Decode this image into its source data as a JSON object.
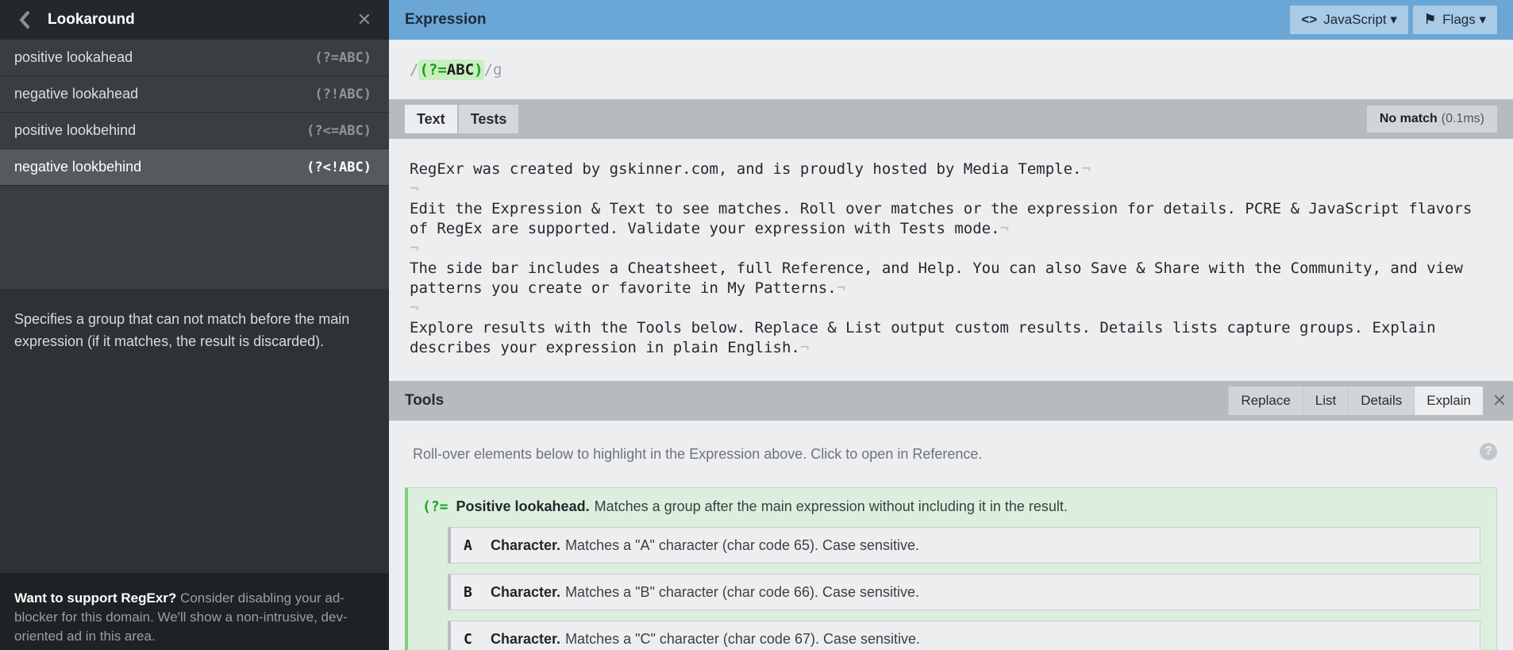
{
  "sidebar": {
    "title": "Lookaround",
    "items": [
      {
        "label": "positive lookahead",
        "code": "(?=ABC)"
      },
      {
        "label": "negative lookahead",
        "code": "(?!ABC)"
      },
      {
        "label": "positive lookbehind",
        "code": "(?<=ABC)"
      },
      {
        "label": "negative lookbehind",
        "code": "(?<!ABC)"
      }
    ],
    "description": "Specifies a group that can not match before the main expression (if it matches, the result is discarded).",
    "ad": {
      "lead": "Want to support RegExr?",
      "body": " Consider disabling your ad-blocker for this domain. We'll show a non-intrusive, dev-oriented ad in this area."
    }
  },
  "expression": {
    "label": "Expression",
    "flavor_button": "JavaScript",
    "flags_button": "Flags",
    "open_slash": "/",
    "group_open": "(?=",
    "group_literal": "ABC",
    "group_close": ")",
    "close_slash_flags": "/g"
  },
  "text": {
    "tabs": [
      "Text",
      "Tests"
    ],
    "status": "No match",
    "time": "(0.1ms)",
    "lines": [
      "RegExr was created by gskinner.com, and is proudly hosted by Media Temple.",
      "",
      "Edit the Expression & Text to see matches. Roll over matches or the expression for details. PCRE & JavaScript flavors of RegEx are supported. Validate your expression with Tests mode.",
      "",
      "The side bar includes a Cheatsheet, full Reference, and Help. You can also Save & Share with the Community, and view patterns you create or favorite in My Patterns.",
      "",
      "Explore results with the Tools below. Replace & List output custom results. Details lists capture groups. Explain describes your expression in plain English."
    ]
  },
  "tools": {
    "label": "Tools",
    "tabs": [
      "Replace",
      "List",
      "Details",
      "Explain"
    ],
    "hint": "Roll-over elements below to highlight in the Expression above. Click to open in Reference.",
    "help": "?",
    "group": {
      "token": "(?=",
      "title": "Positive lookahead.",
      "desc": "Matches a group after the main expression without including it in the result."
    },
    "items": [
      {
        "token": "A",
        "title": "Character.",
        "desc": "Matches a \"A\" character (char code 65). Case sensitive."
      },
      {
        "token": "B",
        "title": "Character.",
        "desc": "Matches a \"B\" character (char code 66). Case sensitive."
      },
      {
        "token": "C",
        "title": "Character.",
        "desc": "Matches a \"C\" character (char code 67). Case sensitive."
      }
    ]
  }
}
